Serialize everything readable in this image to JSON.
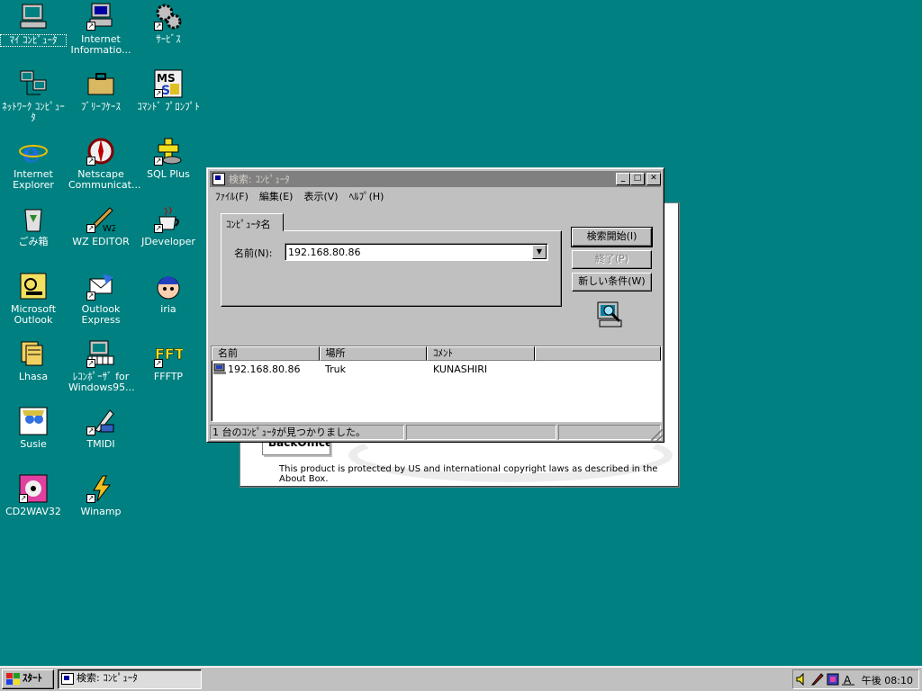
{
  "desktop": {
    "icons": [
      {
        "label": "ﾏｲ ｺﾝﾋﾟｭｰﾀ",
        "icon": "my-computer-icon"
      },
      {
        "label": "Internet Informatio...",
        "icon": "internet-information-icon"
      },
      {
        "label": "ｻｰﾋﾞｽ",
        "icon": "services-icon"
      },
      {
        "label": "ﾈｯﾄﾜｰｸ ｺﾝﾋﾟｭｰﾀ",
        "icon": "network-computer-icon"
      },
      {
        "label": "ﾌﾞﾘｰﾌｹｰｽ",
        "icon": "briefcase-icon"
      },
      {
        "label": "ｺﾏﾝﾄﾞ ﾌﾟﾛﾝﾌﾟﾄ",
        "icon": "command-prompt-icon"
      },
      {
        "label": "Internet Explorer",
        "icon": "internet-explorer-icon"
      },
      {
        "label": "Netscape Communicat...",
        "icon": "netscape-icon"
      },
      {
        "label": "SQL Plus",
        "icon": "sql-plus-icon"
      },
      {
        "label": "ごみ箱",
        "icon": "recycle-bin-icon"
      },
      {
        "label": "WZ EDITOR",
        "icon": "wz-editor-icon"
      },
      {
        "label": "JDeveloper",
        "icon": "jdeveloper-icon"
      },
      {
        "label": "Microsoft Outlook",
        "icon": "outlook-icon"
      },
      {
        "label": "Outlook Express",
        "icon": "outlook-express-icon"
      },
      {
        "label": "iria",
        "icon": "iria-icon"
      },
      {
        "label": "Lhasa",
        "icon": "lhasa-icon"
      },
      {
        "label": "ﾚｺﾝﾎﾟｰｻﾞ for Windows95...",
        "icon": "recomposer-icon"
      },
      {
        "label": "FFFTP",
        "icon": "ffftp-icon"
      },
      {
        "label": "Susie",
        "icon": "susie-icon"
      },
      {
        "label": "TMIDI",
        "icon": "tmidi-icon"
      },
      {
        "label": "CD2WAV32",
        "icon": "cd2wav-icon"
      },
      {
        "label": "Winamp",
        "icon": "winamp-icon"
      }
    ]
  },
  "background_dialog": {
    "product_name": "BackOffice",
    "copyright": "This product is protected by US and international copyright laws as described in the About Box."
  },
  "window": {
    "title": "検索: ｺﾝﾋﾟｭｰﾀ",
    "menu": [
      "ﾌｧｲﾙ(F)",
      "編集(E)",
      "表示(V)",
      "ﾍﾙﾌﾟ(H)"
    ],
    "tab_label": "ｺﾝﾋﾟｭｰﾀ名",
    "name_label": "名前(N):",
    "name_value": "192.168.80.86",
    "buttons": {
      "start_search": "検索開始(I)",
      "stop": "終了(P)",
      "new_search": "新しい条件(W)"
    },
    "results": {
      "columns": [
        "名前",
        "場所",
        "ｺﾒﾝﾄ",
        ""
      ],
      "rows": [
        {
          "name": "192.168.80.86",
          "location": "Truk",
          "comment": "KUNASHIRI"
        }
      ]
    },
    "status": "1 台のｺﾝﾋﾟｭｰﾀが見つかりました。"
  },
  "taskbar": {
    "start_label": "ｽﾀｰﾄ",
    "task_label": "検索: ｺﾝﾋﾟｭｰﾀ",
    "clock": "午後 08:10"
  },
  "colors": {
    "desktop": "#008080",
    "face": "#c0c0c0",
    "inactive_title": "#808080"
  }
}
